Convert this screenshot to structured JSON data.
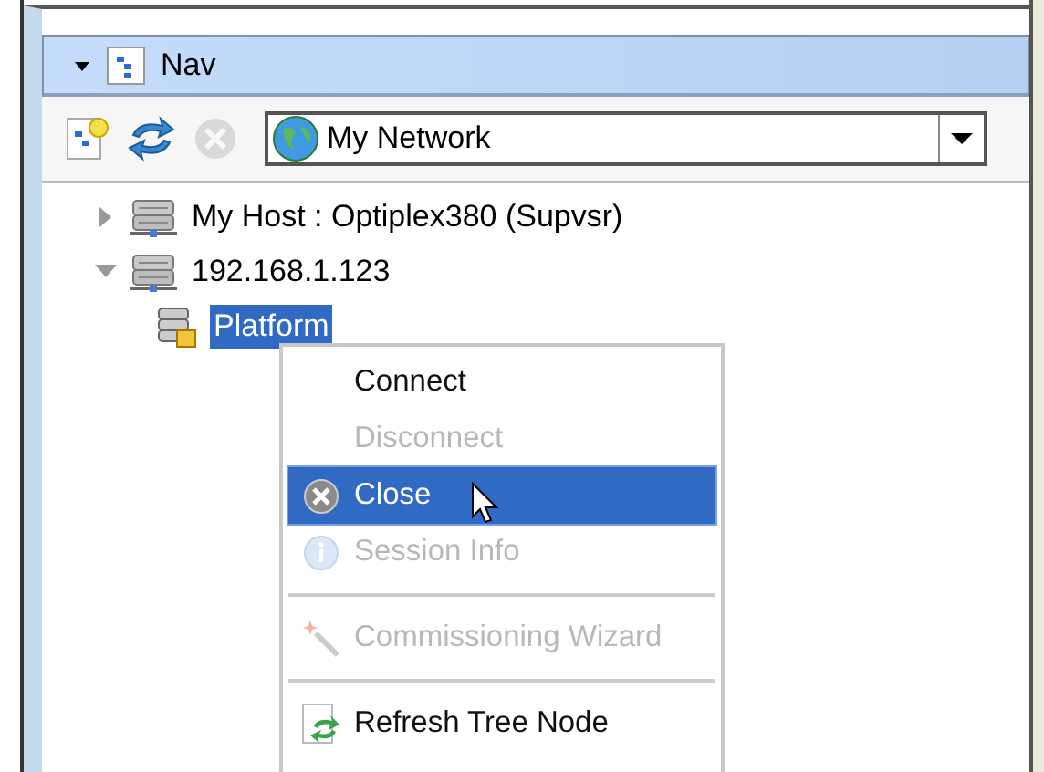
{
  "panel": {
    "title": "Nav",
    "expanded": true
  },
  "toolbar": {
    "network": "My Network",
    "close_disabled": true
  },
  "tree": [
    {
      "label": "My Host : Optiplex380 (Supvsr)",
      "expanded": false,
      "selected": false,
      "kind": "host"
    },
    {
      "label": "192.168.1.123",
      "expanded": true,
      "selected": false,
      "kind": "host",
      "children": [
        {
          "label": "Platform",
          "selected": true,
          "kind": "platform"
        }
      ]
    }
  ],
  "context_menu": [
    {
      "kind": "item",
      "label": "Connect",
      "disabled": false,
      "selected": false
    },
    {
      "kind": "item",
      "label": "Disconnect",
      "disabled": true,
      "selected": false
    },
    {
      "kind": "item",
      "label": "Close",
      "disabled": false,
      "selected": true
    },
    {
      "kind": "item",
      "label": "Session Info",
      "disabled": true,
      "selected": false
    },
    {
      "kind": "separator"
    },
    {
      "kind": "item",
      "label": "Commissioning Wizard",
      "disabled": true,
      "selected": false
    },
    {
      "kind": "separator"
    },
    {
      "kind": "item",
      "label": "Refresh Tree Node",
      "disabled": false,
      "selected": false
    }
  ]
}
